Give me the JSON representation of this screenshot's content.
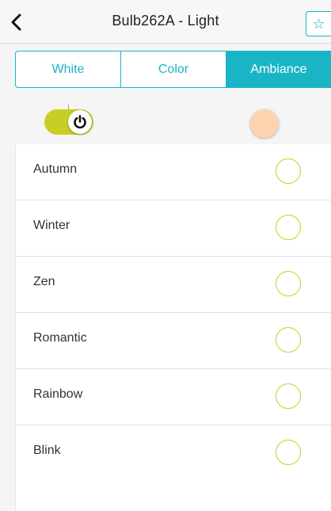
{
  "header": {
    "title": "Bulb262A - Light",
    "back_icon": "chevron-left-icon",
    "favorite_icon": "star-icon",
    "favorite_glyph": "☆"
  },
  "tabs": [
    {
      "label": "White",
      "active": false
    },
    {
      "label": "Color",
      "active": false
    },
    {
      "label": "Ambiance",
      "active": true
    }
  ],
  "controls": {
    "power_on": true,
    "power_icon": "power-icon",
    "color_swatch": "#fdd3b0"
  },
  "scenes": [
    {
      "label": "Autumn",
      "selected": false
    },
    {
      "label": "Winter",
      "selected": false
    },
    {
      "label": "Zen",
      "selected": false
    },
    {
      "label": "Romantic",
      "selected": false
    },
    {
      "label": "Rainbow",
      "selected": false
    },
    {
      "label": "Blink",
      "selected": false
    }
  ],
  "colors": {
    "accent": "#19b5c6",
    "toggle_on": "#c8cf24",
    "radio_border": "#c8cf24"
  }
}
